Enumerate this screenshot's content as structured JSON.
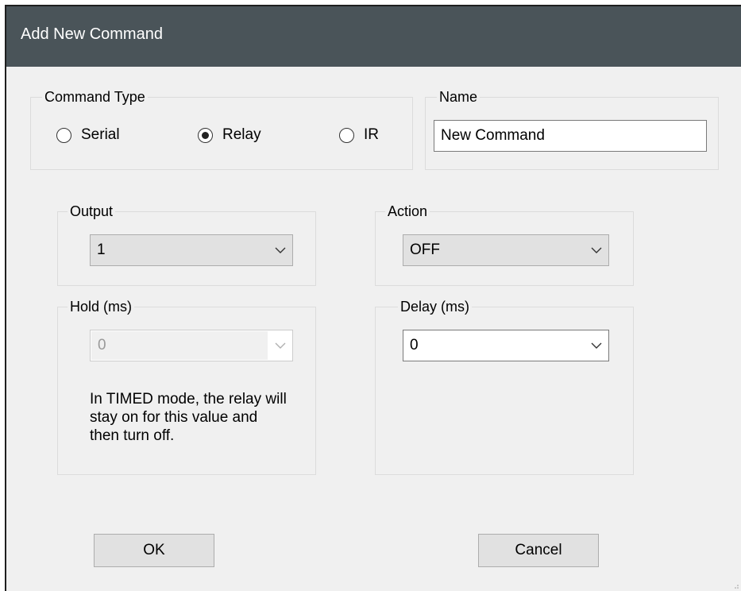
{
  "window": {
    "title": "Add New Command"
  },
  "command_type": {
    "legend": "Command Type",
    "options": [
      {
        "label": "Serial",
        "selected": false
      },
      {
        "label": "Relay",
        "selected": true
      },
      {
        "label": "IR",
        "selected": false
      }
    ]
  },
  "name": {
    "legend": "Name",
    "value": "New Command"
  },
  "output": {
    "legend": "Output",
    "value": "1"
  },
  "action": {
    "legend": "Action",
    "value": "OFF"
  },
  "hold": {
    "legend": "Hold (ms)",
    "value": "0",
    "disabled": true,
    "note": "In TIMED mode, the relay will stay on for this value and then turn off."
  },
  "delay": {
    "legend": "Delay (ms)",
    "value": "0"
  },
  "buttons": {
    "ok": "OK",
    "cancel": "Cancel"
  },
  "icons": {
    "dropdown": "chevron-down-icon",
    "radio_selected": "radio-dot-icon"
  }
}
